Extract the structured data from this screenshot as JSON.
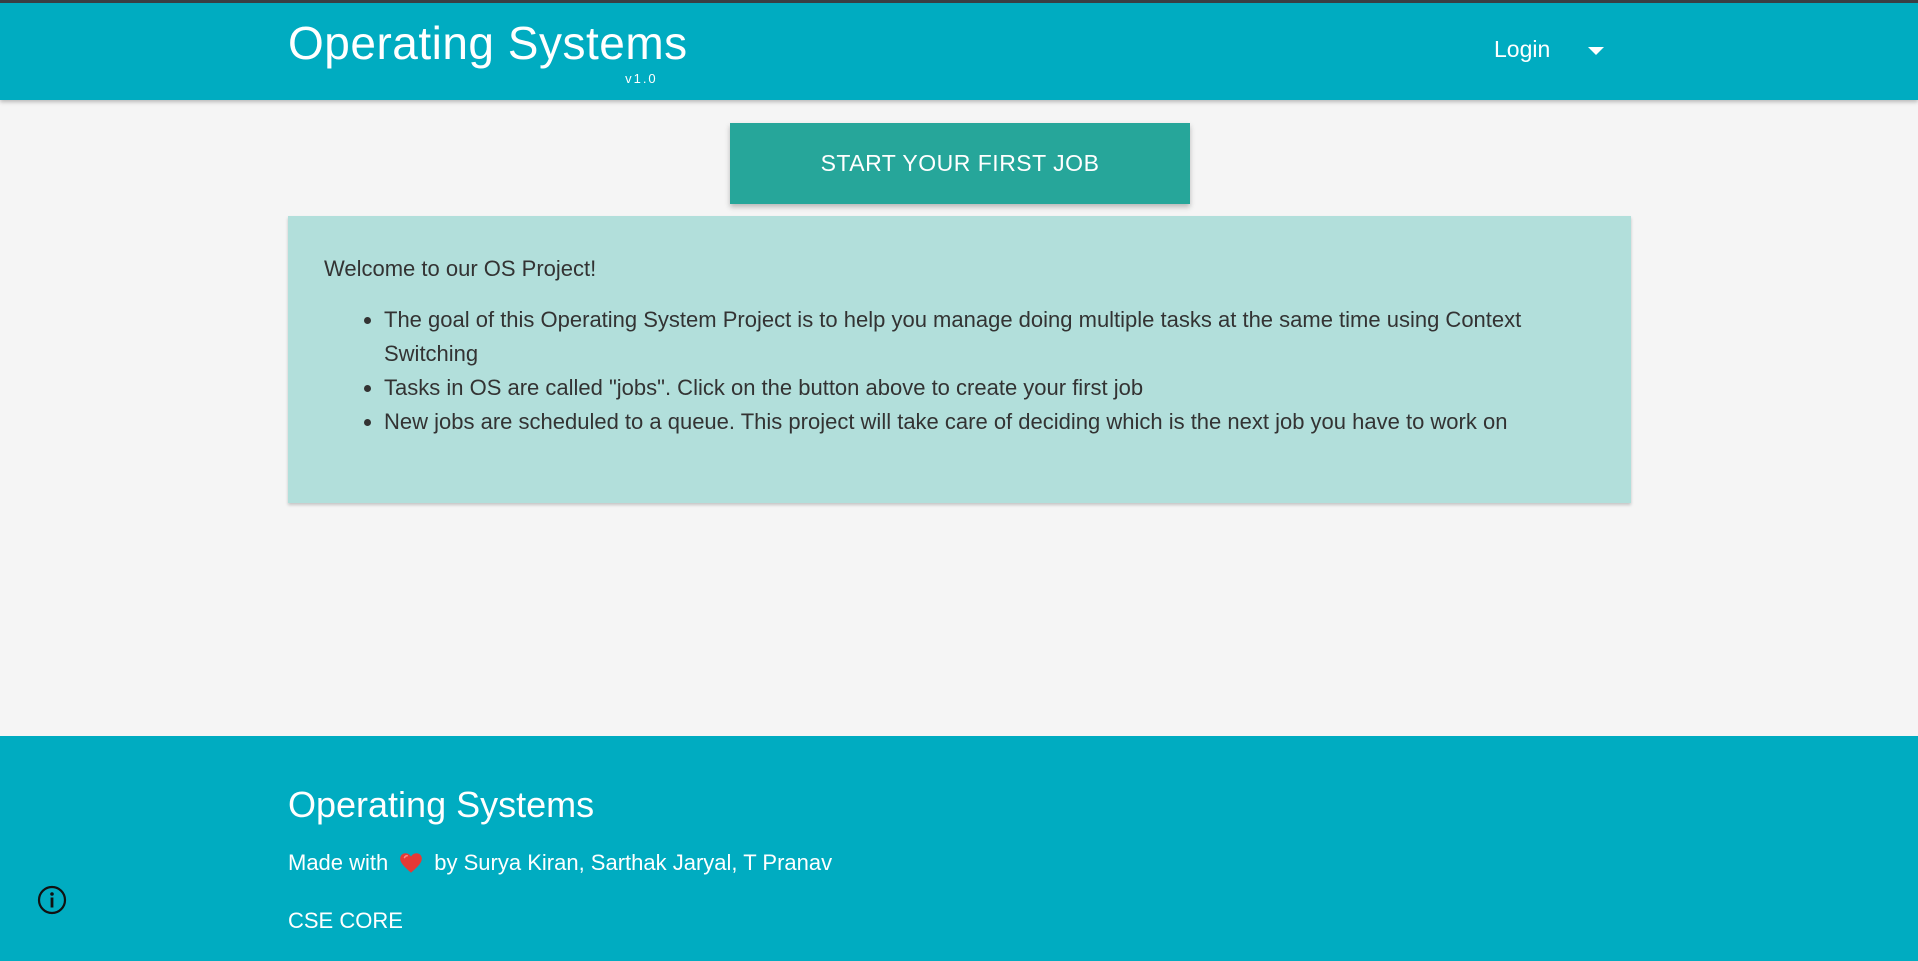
{
  "navbar": {
    "brand_title": "Operating Systems",
    "brand_version": "v1.0",
    "login_label": "Login",
    "caret_icon": "caret-down-icon",
    "background_color": "#00acc1"
  },
  "cta": {
    "label": "START YOUR FIRST JOB",
    "color": "#26a69a"
  },
  "info_card": {
    "heading": "Welcome to our OS Project!",
    "items": [
      "The goal of this Operating System Project is to help you manage doing multiple tasks at the same time using Context Switching",
      "Tasks in OS are called \"jobs\". Click on the button above to create your first job",
      "New jobs are scheduled to a queue. This project will take care of deciding which is the next job you have to work on"
    ],
    "background_color": "#b2dfdb"
  },
  "footer": {
    "title": "Operating Systems",
    "made_with": "Made with",
    "heart_icon": "heart-icon",
    "credits": "by Surya Kiran, Sarthak Jaryal, T Pranav",
    "org": "CSE CORE",
    "info_icon": "info-icon",
    "background_color": "#00acc1"
  }
}
